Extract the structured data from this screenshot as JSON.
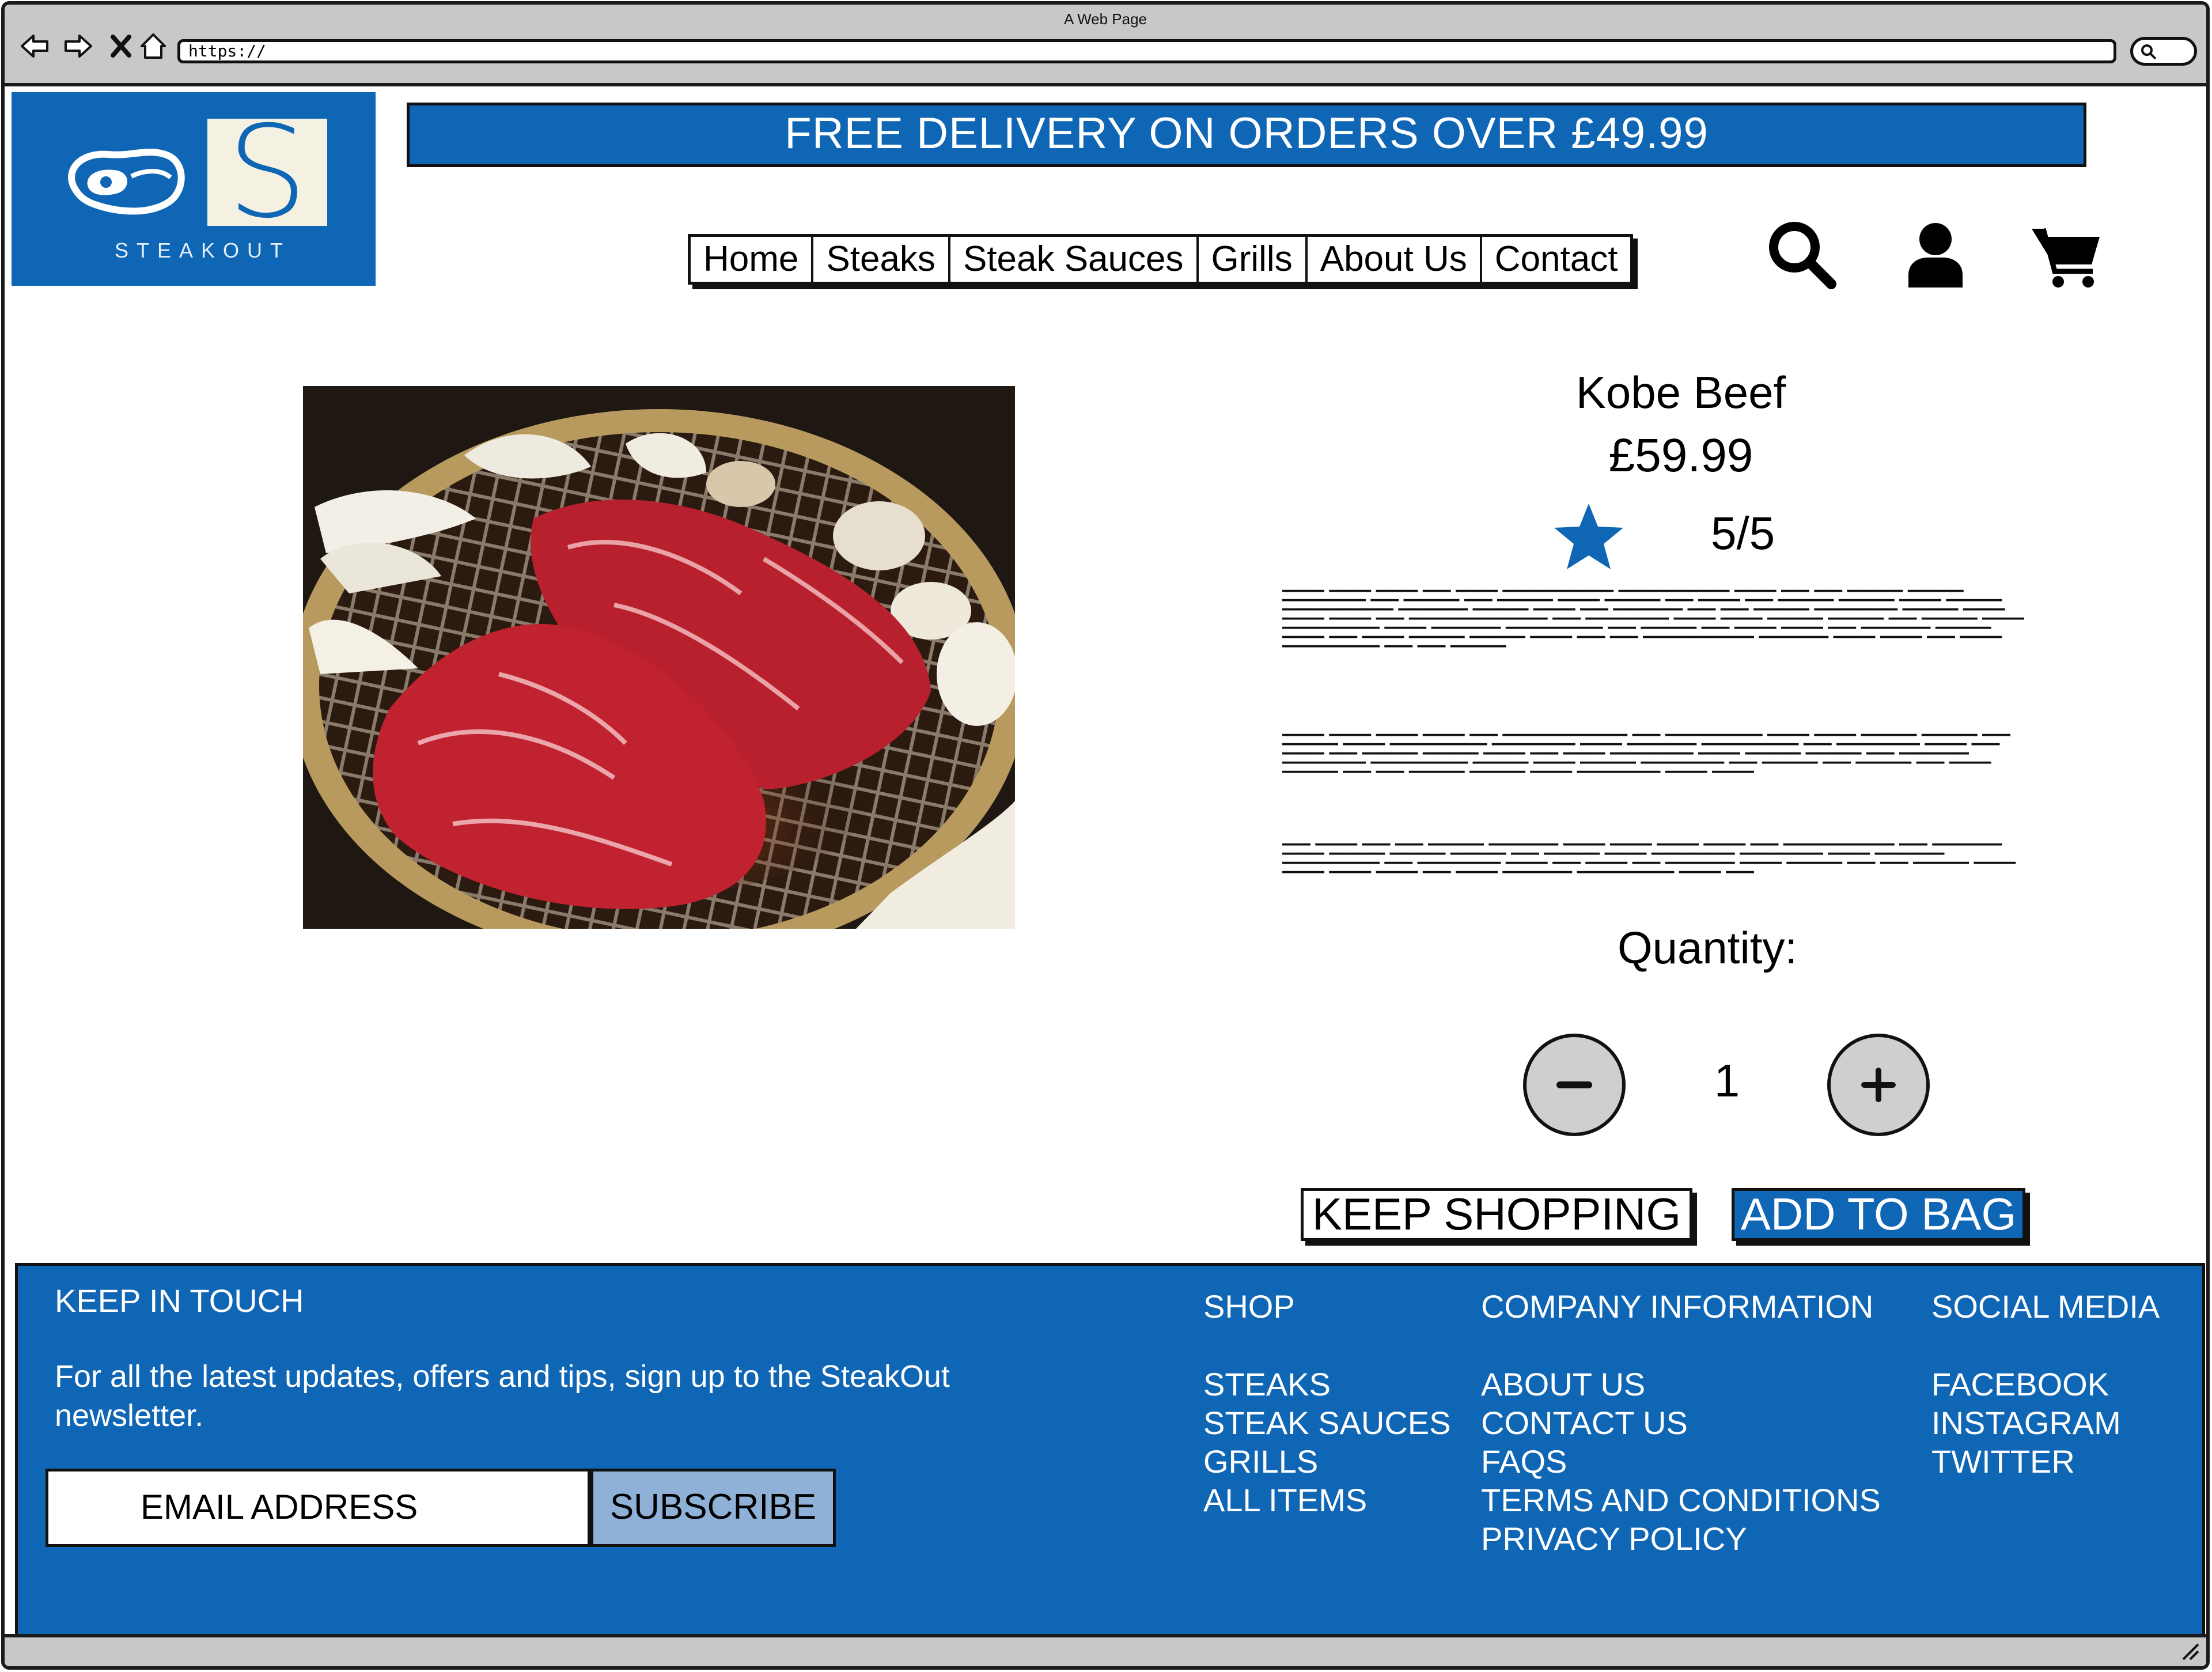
{
  "browser": {
    "window_title": "A Web Page",
    "url": "https://"
  },
  "header": {
    "logo_text": "STEAKOUT",
    "logo_letter": "S",
    "promo_banner": "FREE DELIVERY ON ORDERS OVER £49.99",
    "nav": [
      "Home",
      "Steaks",
      "Steak Sauces",
      "Grills",
      "About Us",
      "Contact"
    ],
    "icons": [
      "search-icon",
      "user-icon",
      "cart-icon"
    ]
  },
  "product": {
    "name": "Kobe Beef",
    "price": "£59.99",
    "rating": "5/5",
    "description": [
      "▬▬▬ ▬▬▬ ▬▬▬ ▬▬ ▬▬▬ ▬▬▬▬▬▬▬▬ ▬▬▬▬▬▬▬▬ ▬▬▬ ▬▬ ▬▬ ▬▬▬▬ ▬▬▬▬ ▬▬▬▬▬▬ ▬▬ ▬▬▬▬ ▬▬ ▬▬▬▬ ▬▬▬ ▬▬▬▬ ▬▬ ▬▬▬ ▬▬ ▬▬▬▬ ▬▬▬▬ ▬▬▬ ▬▬▬▬ ▬▬▬▬▬▬▬▬ ▬▬▬▬▬ ▬▬▬▬ ▬▬▬ ▬▬ ▬▬▬▬▬ ▬▬ ▬▬ ▬▬▬▬ ▬▬▬▬▬▬ ▬▬▬▬ ▬▬▬ ▬▬▬ ▬▬▬ ▬▬ ▬▬▬▬▬▬▬▬▬▬ ▬▬ ▬▬▬▬▬▬ ▬▬▬ ▬▬▬ ▬▬▬▬ ▬▬▬▬ ▬▬ ▬▬▬▬ ▬▬▬ ▬▬▬▬▬▬▬ ▬▬▬ ▬▬▬▬▬ ▬▬▬▬▬▬▬ ▬▬ ▬▬▬▬ ▬▬ ▬▬▬ ▬▬▬ ▬▬ ▬▬▬▬▬ ▬▬▬▬ ▬▬▬ ▬▬ ▬▬▬ ▬▬▬▬ ▬▬▬▬ ▬▬▬ ▬▬ ▬▬ ▬▬▬▬▬▬▬▬ ▬▬▬▬▬ ▬▬▬ ▬▬▬ ▬▬ ▬▬▬ ▬▬▬▬▬▬▬ ▬▬ ▬▬ ▬▬▬▬",
      "▬▬▬ ▬▬▬ ▬▬▬ ▬▬▬ ▬▬ ▬▬▬▬▬▬▬▬▬ ▬▬ ▬▬▬▬▬▬▬ ▬▬▬ ▬▬▬ ▬▬▬▬ ▬▬▬▬ ▬▬ ▬▬▬▬ ▬▬▬ ▬▬▬▬▬▬▬ ▬▬▬▬▬▬ ▬▬▬ ▬▬▬▬▬ ▬▬▬▬▬▬▬ ▬▬ ▬▬▬▬▬▬ ▬▬▬ ▬▬ ▬▬▬ ▬▬ ▬▬▬▬ ▬▬▬▬ ▬▬▬ ▬▬ ▬▬▬ ▬▬▬▬▬▬ ▬▬▬ ▬▬▬▬ ▬▬▬▬ ▬▬ ▬▬▬▬▬ ▬▬▬▬▬▬ ▬▬▬▬▬▬▬ ▬▬▬▬ ▬▬▬ ▬▬▬▬ ▬▬▬▬▬▬ ▬▬ ▬▬▬▬ ▬▬ ▬▬▬▬ ▬▬ ▬▬▬ ▬▬▬▬ ▬▬ ▬▬ ▬▬▬▬ ▬▬▬▬ ▬▬▬ ▬▬▬▬▬▬ ▬▬▬ ▬▬▬",
      "▬▬ ▬▬▬ ▬▬ ▬▬ ▬▬▬▬ ▬▬▬▬▬ ▬▬▬ ▬▬▬ ▬▬▬ ▬▬▬ ▬▬ ▬▬▬▬▬▬▬▬ ▬▬ ▬▬▬▬▬ ▬▬▬ ▬▬▬▬ ▬▬▬▬ ▬▬▬▬ ▬▬ ▬▬▬▬ ▬▬▬ ▬▬▬▬▬▬ ▬▬▬▬▬▬ ▬▬▬ ▬▬▬▬▬ ▬▬▬▬▬▬▬ ▬▬ ▬▬▬▬▬▬ ▬▬▬ ▬▬ ▬▬▬ ▬▬ ▬▬▬▬▬ ▬▬▬ ▬▬▬▬ ▬▬ ▬▬ ▬▬▬▬ ▬▬▬ ▬▬▬ ▬▬▬ ▬▬▬ ▬▬ ▬▬▬ ▬▬▬▬▬ ▬▬▬▬▬▬▬ ▬▬▬ ▬▬"
    ],
    "quantity_label": "Quantity:",
    "quantity_value": "1",
    "keep_shopping_label": "KEEP SHOPPING",
    "add_to_bag_label": "ADD TO BAG"
  },
  "footer": {
    "keep_in_touch": "KEEP IN TOUCH",
    "newsletter_text": "For all the latest updates, offers and tips, sign up to the SteakOut newsletter.",
    "email_placeholder": "EMAIL ADDRESS",
    "subscribe_label": "SUBSCRIBE",
    "shop": {
      "heading": "SHOP",
      "links": [
        "STEAKS",
        "STEAK SAUCES",
        "GRILLS",
        "ALL ITEMS"
      ]
    },
    "company": {
      "heading": "COMPANY INFORMATION",
      "links": [
        "ABOUT US",
        "CONTACT US",
        "FAQS",
        "TERMS AND CONDITIONS",
        "PRIVACY POLICY"
      ]
    },
    "social": {
      "heading": "SOCIAL MEDIA",
      "links": [
        "FACEBOOK",
        "INSTAGRAM",
        "TWITTER"
      ]
    }
  },
  "colors": {
    "brand_blue": "#0f66b5",
    "subscribe_blue": "#8fb1d8",
    "chrome_grey": "#c8c8c8"
  }
}
